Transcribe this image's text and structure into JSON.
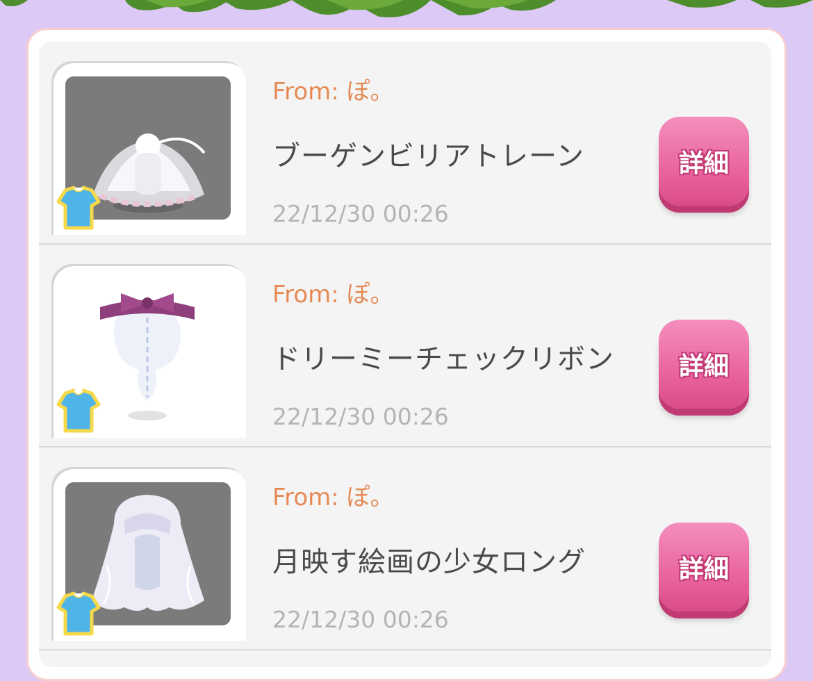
{
  "items": [
    {
      "from": "From: ぽ。",
      "name": "ブーゲンビリアトレーン",
      "date": "22/12/30 00:26",
      "button": "詳細",
      "thumb_bg": "#7b7b7b",
      "item_icon": "train-skirt-icon",
      "category_icon": "outfit-icon"
    },
    {
      "from": "From: ぽ。",
      "name": "ドリーミーチェックリボン",
      "date": "22/12/30 00:26",
      "button": "詳細",
      "thumb_bg": "#ffffff",
      "item_icon": "ribbon-headband-icon",
      "category_icon": "outfit-icon"
    },
    {
      "from": "From: ぽ。",
      "name": "月映す絵画の少女ロング",
      "date": "22/12/30 00:26",
      "button": "詳細",
      "thumb_bg": "#7b7b7b",
      "item_icon": "long-hair-icon",
      "category_icon": "outfit-icon"
    }
  ],
  "colors": {
    "background": "#dcc9f5",
    "from_text": "#e58a55",
    "button": "#e9649f"
  }
}
